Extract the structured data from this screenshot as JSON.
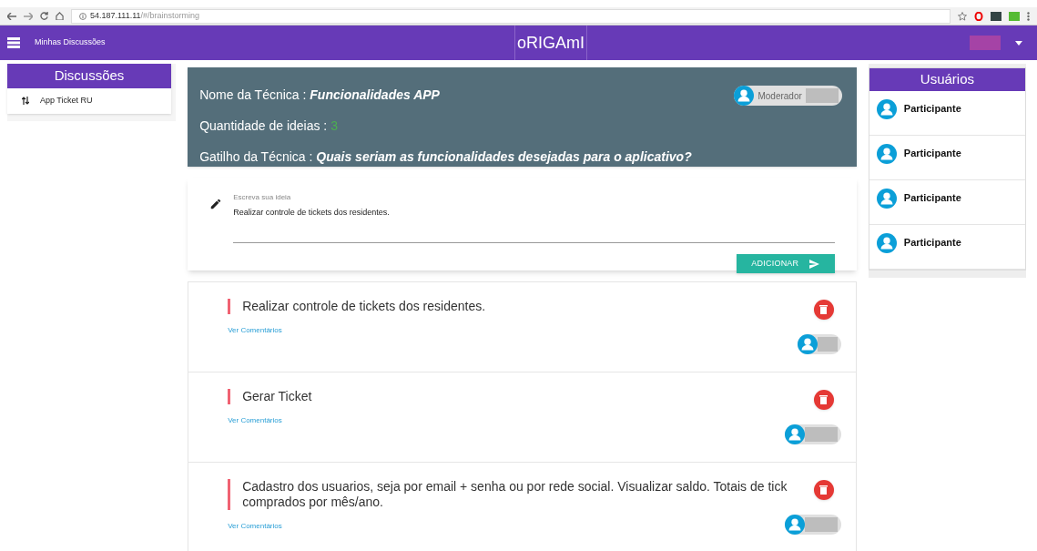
{
  "browser": {
    "url_host": "54.187.111.11",
    "url_path": "/#/brainstorming"
  },
  "header": {
    "menu_label": "Minhas Discussões",
    "logo": "oRIGAmI"
  },
  "discussions": {
    "title": "Discussões",
    "items": [
      {
        "label": "App Ticket RU"
      }
    ]
  },
  "technique": {
    "name_label": "Nome da Técnica : ",
    "name": "Funcionalidades APP",
    "count_label": "Quantidade de ideias : ",
    "count": "3",
    "trigger_label": "Gatilho da Técnica : ",
    "trigger": "Quais seriam as funcionalidades desejadas para o aplicativo?",
    "moderator": {
      "label": "Moderador",
      "on": false
    }
  },
  "idea_form": {
    "placeholder": "Escreva sua ideia",
    "value": "Realizar controle de tickets dos residentes.",
    "button": "ADICIONAR"
  },
  "ideas": [
    {
      "lines": [
        "Realizar controle de tickets dos residentes."
      ],
      "link": "Ver Comentários",
      "on": false
    },
    {
      "lines": [
        "Gerar Ticket"
      ],
      "link": "Ver Comentários",
      "on": false
    },
    {
      "lines": [
        "Cadastro dos usuarios, seja por email + senha ou por rede social. Visualizar saldo. Totais de tick",
        "comprados por mês/ano."
      ],
      "link": "Ver Comentários",
      "on": false
    }
  ],
  "users": {
    "title": "Usuários",
    "items": [
      {
        "label": "Participante"
      },
      {
        "label": "Participante"
      },
      {
        "label": "Participante"
      },
      {
        "label": "Participante"
      }
    ]
  }
}
